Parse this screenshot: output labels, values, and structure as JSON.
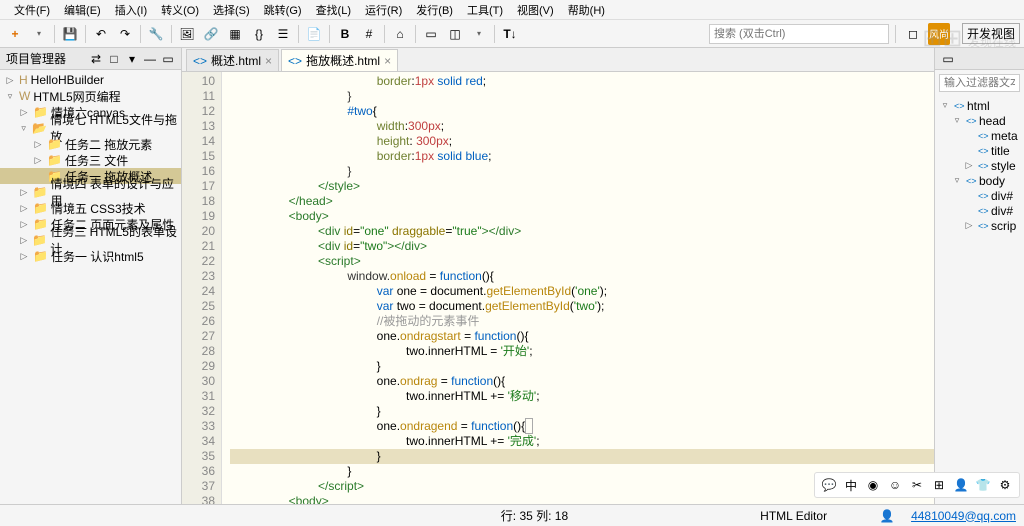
{
  "menubar": [
    "文件(F)",
    "编辑(E)",
    "插入(I)",
    "转义(O)",
    "选择(S)",
    "跳转(G)",
    "查找(L)",
    "运行(R)",
    "发行(B)",
    "工具(T)",
    "视图(V)",
    "帮助(H)"
  ],
  "search_placeholder": "搜索 (双击Ctrl)",
  "dev_view_label": "开发视图",
  "watermark": "发现在线",
  "pm": {
    "title": "项目管理器",
    "tree": [
      {
        "label": "HelloHBuilder",
        "indent": 0,
        "tw": "▷",
        "icon": "H"
      },
      {
        "label": "HTML5网页编程",
        "indent": 0,
        "tw": "▿",
        "icon": "W"
      },
      {
        "label": "情境六canvas",
        "indent": 1,
        "tw": "▷",
        "icon": "📁"
      },
      {
        "label": "情境七 HTML5文件与拖放",
        "indent": 1,
        "tw": "▿",
        "icon": "📂"
      },
      {
        "label": "任务二 拖放元素",
        "indent": 2,
        "tw": "▷",
        "icon": "📁"
      },
      {
        "label": "任务三 文件",
        "indent": 2,
        "tw": "▷",
        "icon": "📁"
      },
      {
        "label": "任务一 拖放概述",
        "indent": 2,
        "tw": "",
        "icon": "📁",
        "selected": true
      },
      {
        "label": "情境四 表单的设计与应用",
        "indent": 1,
        "tw": "▷",
        "icon": "📁"
      },
      {
        "label": "情境五 CSS3技术",
        "indent": 1,
        "tw": "▷",
        "icon": "📁"
      },
      {
        "label": "任务二 页面元素及属性",
        "indent": 1,
        "tw": "▷",
        "icon": "📁"
      },
      {
        "label": "任务三 HTML5的表单设计",
        "indent": 1,
        "tw": "▷",
        "icon": "📁"
      },
      {
        "label": "任务一 认识html5",
        "indent": 1,
        "tw": "▷",
        "icon": "📁"
      }
    ]
  },
  "tabs": [
    {
      "label": "概述.html",
      "active": false
    },
    {
      "label": "拖放概述.html",
      "active": true
    }
  ],
  "lines_start": 10,
  "lines_end": 38,
  "code_lines": [
    {
      "indent": 20,
      "html": "<span class='t-prop'>border</span>:<span class='t-num'>1px</span> <span class='t-kw'>solid</span> <span class='t-kw'>red</span>;"
    },
    {
      "indent": 16,
      "html": "<span class='t-plain'>}</span>"
    },
    {
      "indent": 16,
      "html": "<span class='t-kw'>#two</span>{"
    },
    {
      "indent": 20,
      "html": "<span class='t-prop'>width</span>:<span class='t-num'>300px</span>;"
    },
    {
      "indent": 20,
      "html": "<span class='t-prop'>height</span>: <span class='t-num'>300px</span>;"
    },
    {
      "indent": 20,
      "html": "<span class='t-prop'>border</span>:<span class='t-num'>1px</span> <span class='t-kw'>solid</span> <span class='t-kw'>blue</span>;"
    },
    {
      "indent": 16,
      "html": "<span class='t-plain'>}</span>"
    },
    {
      "indent": 12,
      "html": "<span class='t-tag'>&lt;/style&gt;</span>"
    },
    {
      "indent": 8,
      "html": "<span class='t-tag'>&lt;/head&gt;</span>"
    },
    {
      "indent": 8,
      "html": "<span class='t-tag'>&lt;body&gt;</span>"
    },
    {
      "indent": 12,
      "html": "<span class='t-tag'>&lt;div</span> <span class='t-attr'>id</span>=<span class='t-str'>\"one\"</span> <span class='t-attr'>draggable</span>=<span class='t-str'>\"true\"</span><span class='t-tag'>&gt;&lt;/div&gt;</span>"
    },
    {
      "indent": 12,
      "html": "<span class='t-tag'>&lt;div</span> <span class='t-attr'>id</span>=<span class='t-str'>\"two\"</span><span class='t-tag'>&gt;&lt;/div&gt;</span>"
    },
    {
      "indent": 12,
      "html": "<span class='t-tag'>&lt;script&gt;</span>"
    },
    {
      "indent": 16,
      "html": "<span class='t-plain'>window.</span><span class='t-func'>onload</span> = <span class='t-kw'>function</span>(){"
    },
    {
      "indent": 20,
      "html": "<span class='t-kw'>var</span> one = document.<span class='t-func'>getElementById</span>(<span class='t-str'>'one'</span>);"
    },
    {
      "indent": 20,
      "html": "<span class='t-kw'>var</span> two = document.<span class='t-func'>getElementById</span>(<span class='t-str'>'two'</span>);"
    },
    {
      "indent": 20,
      "html": "<span class='t-comment'>//被拖动的元素事件</span>"
    },
    {
      "indent": 20,
      "html": "one.<span class='t-func'>ondragstart</span> = <span class='t-kw'>function</span>(){"
    },
    {
      "indent": 24,
      "html": "two.innerHTML = <span class='t-str'>'开始'</span>;"
    },
    {
      "indent": 20,
      "html": "}"
    },
    {
      "indent": 20,
      "html": "one.<span class='t-func'>ondrag</span> = <span class='t-kw'>function</span>(){"
    },
    {
      "indent": 24,
      "html": "two.innerHTML += <span class='t-str'>'移动'</span>;"
    },
    {
      "indent": 20,
      "html": "}"
    },
    {
      "indent": 20,
      "html": "one.<span class='t-func'>ondragend</span> = <span class='t-kw'>function</span>(){<span style='border:1px solid #aaa;padding:0 1px'>&nbsp;</span>"
    },
    {
      "indent": 24,
      "html": "two.innerHTML += <span class='t-str'>'完成'</span>;"
    },
    {
      "indent": 20,
      "html": "}",
      "hl": true
    },
    {
      "indent": 16,
      "html": "}"
    },
    {
      "indent": 12,
      "html": "<span class='t-tag'>&lt;/script&gt;</span>"
    },
    {
      "indent": 8,
      "html": "<span class='t-tag'>&lt;body&gt;</span>"
    }
  ],
  "outline": {
    "filter_placeholder": "输入过滤器文本",
    "items": [
      {
        "label": "html",
        "indent": 0,
        "tw": "▿"
      },
      {
        "label": "head",
        "indent": 1,
        "tw": "▿"
      },
      {
        "label": "meta",
        "indent": 2,
        "tw": ""
      },
      {
        "label": "title",
        "indent": 2,
        "tw": ""
      },
      {
        "label": "style",
        "indent": 2,
        "tw": "▷"
      },
      {
        "label": "body",
        "indent": 1,
        "tw": "▿"
      },
      {
        "label": "div#",
        "indent": 2,
        "tw": ""
      },
      {
        "label": "div#",
        "indent": 2,
        "tw": ""
      },
      {
        "label": "scrip",
        "indent": 2,
        "tw": "▷"
      }
    ]
  },
  "status": {
    "pos": "行: 35 列: 18",
    "editor": "HTML Editor",
    "email": "44810049@qq.com"
  }
}
